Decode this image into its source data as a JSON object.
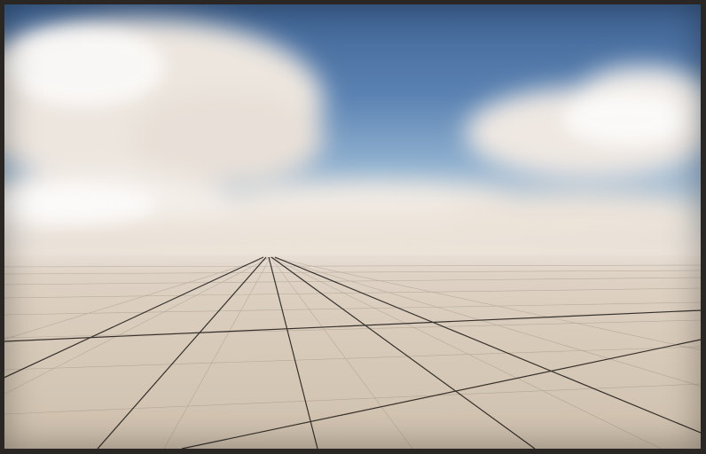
{
  "scene": {
    "sky_color": "#5a82b2",
    "cloud_color": "#f2ece6",
    "ground_color": "#d8cbbb",
    "grid_color": "#1a1612"
  }
}
